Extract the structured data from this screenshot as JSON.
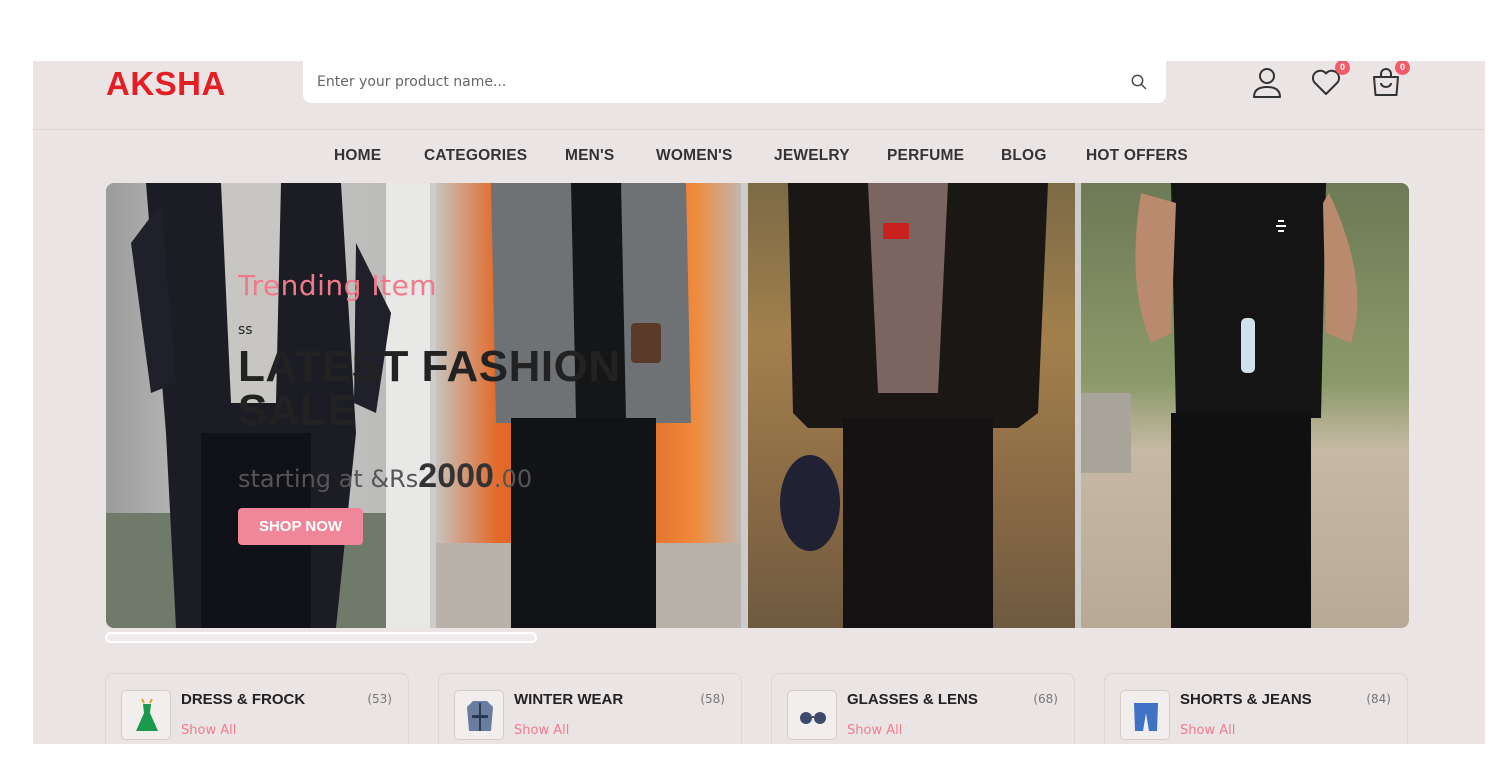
{
  "header": {
    "logo": "AKSHA",
    "search_placeholder": "Enter your product name...",
    "wishlist_count": "0",
    "cart_count": "0"
  },
  "nav": {
    "items": [
      "HOME",
      "CATEGORIES",
      "MEN'S",
      "WOMEN'S",
      "JEWELRY",
      "PERFUME",
      "BLOG",
      "HOT OFFERS"
    ]
  },
  "hero": {
    "subtitle": "Trending Item",
    "small": "ss",
    "title": "LATEST FASHION SALE",
    "price_prefix": "starting at &Rs",
    "price_main": "2000",
    "price_cents": ".00",
    "button": "SHOP NOW"
  },
  "categories": [
    {
      "title": "DRESS & FROCK",
      "count": "(53)",
      "link": "Show All",
      "icon": "dress-icon"
    },
    {
      "title": "WINTER WEAR",
      "count": "(58)",
      "link": "Show All",
      "icon": "coat-icon"
    },
    {
      "title": "GLASSES & LENS",
      "count": "(68)",
      "link": "Show All",
      "icon": "glasses-icon"
    },
    {
      "title": "SHORTS & JEANS",
      "count": "(84)",
      "link": "Show All",
      "icon": "shorts-icon"
    }
  ],
  "colors": {
    "brand": "#e31e24",
    "accent": "#f0869a",
    "badge": "#f45b69",
    "background": "#ebe4e4"
  }
}
